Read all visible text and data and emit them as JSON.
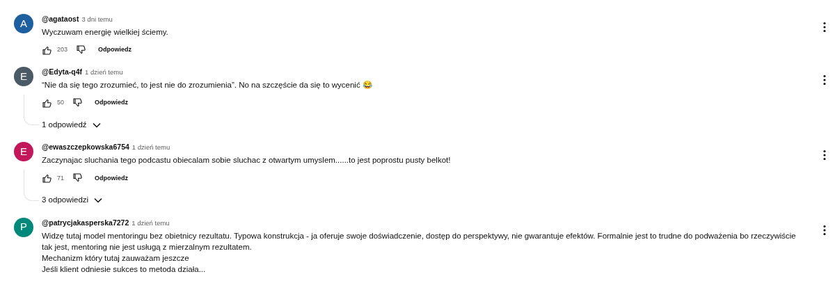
{
  "comments": [
    {
      "avatar_letter": "A",
      "color": "#1e5fa0",
      "author": "@agataost",
      "time": "3 dni temu",
      "lines": [
        "Wyczuwam energię wielkiej ściemy."
      ],
      "likes": "203",
      "reply_label": "Odpowiedz"
    },
    {
      "avatar_letter": "E",
      "color": "#4a5a66",
      "author": "@Edyta-q4f",
      "time": "1 dzień temu",
      "lines": [
        "“Nie da się tego zrozumieć, to jest nie do zrozumienia”. No na szczęście da się to wycenić 😂"
      ],
      "likes": "50",
      "reply_label": "Odpowiedz",
      "replies_toggle": "1 odpowiedź"
    },
    {
      "avatar_letter": "E",
      "color": "#c2185b",
      "author": "@ewaszczepkowska6754",
      "time": "1 dzień temu",
      "lines": [
        "Zaczynajac sluchania tego podcastu obiecalam sobie sluchac z otwartym umyslem......to jest poprostu pusty belkot!"
      ],
      "likes": "71",
      "reply_label": "Odpowiedz",
      "replies_toggle": "3 odpowiedzi"
    },
    {
      "avatar_letter": "P",
      "color": "#00897b",
      "author": "@patrycjakasperska7272",
      "time": "1 dzień temu",
      "lines": [
        "Widzę tutaj model mentoringu bez obietnicy rezultatu. Typowa konstrukcja - ja oferuje swoje doświadczenie, dostęp do perspektywy, nie gwarantuje efektów. Formalnie jest to trudne do podważenia bo rzeczywiście tak jest, mentoring nie jest usługą z mierzalnym rezultatem.",
        "Mechanizm który tutaj zauważam jeszcze",
        "Jeśli klient odniesie sukces to metoda działa..."
      ]
    }
  ]
}
